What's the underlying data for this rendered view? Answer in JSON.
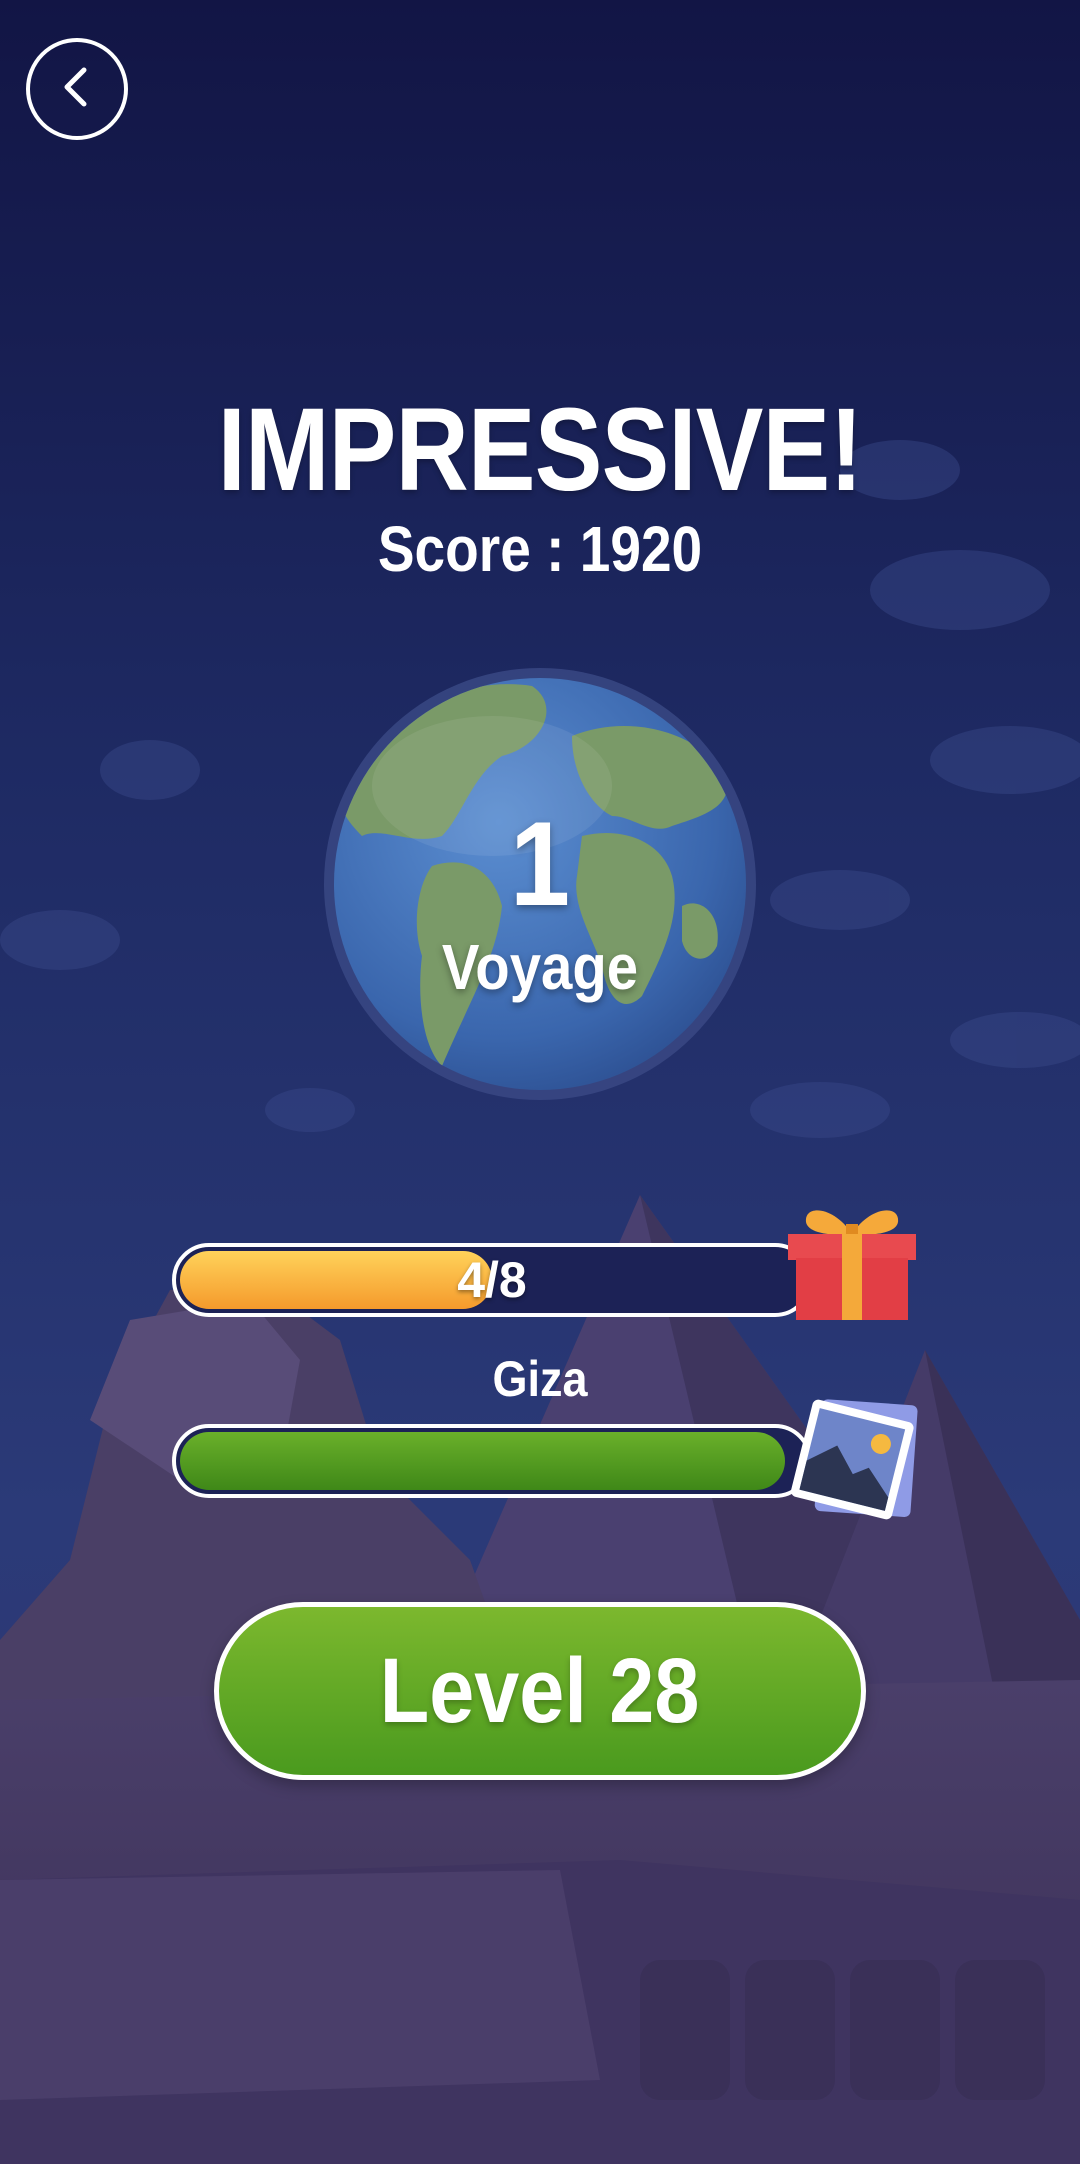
{
  "screen": {
    "headline": "IMPRESSIVE!",
    "score_text": "Score : 1920"
  },
  "voyage": {
    "number": "1",
    "label": "Voyage"
  },
  "chest_progress": {
    "current": 4,
    "total": 8,
    "text": "4/8",
    "fraction": 0.5,
    "color": "#f7a83a"
  },
  "location_progress": {
    "name": "Giza",
    "fraction": 0.97,
    "color": "#4f9a1f"
  },
  "next_level": {
    "label": "Level 28",
    "color": "#62a824"
  },
  "icons": {
    "back": "chevron-left-icon",
    "reward": "gift-icon",
    "picture": "photo-icon",
    "globe": "globe-icon"
  }
}
